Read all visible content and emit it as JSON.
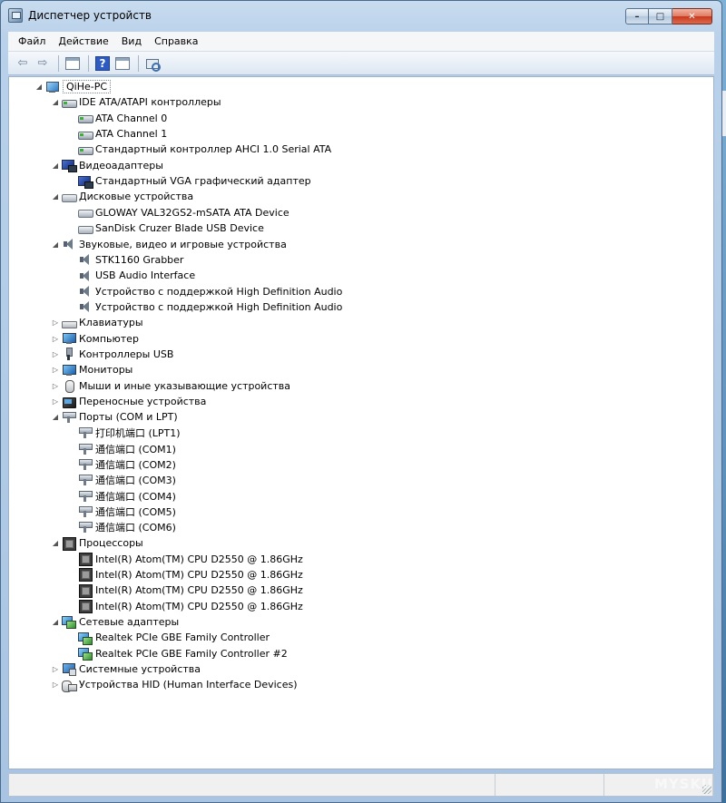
{
  "window": {
    "title": "Диспетчер устройств",
    "buttons": {
      "minimize": "–",
      "maximize": "□",
      "close": "✕"
    }
  },
  "menu": [
    "Файл",
    "Действие",
    "Вид",
    "Справка"
  ],
  "toolbar": {
    "back_icon": "arrow-left-icon",
    "forward_icon": "arrow-right-icon",
    "help_label": "?"
  },
  "tree": [
    {
      "level": 0,
      "label": "QiHe-PC",
      "icon": "computer",
      "expander": "◢",
      "root": true
    },
    {
      "level": 1,
      "label": "IDE ATA/ATAPI контроллеры",
      "icon": "ide",
      "expander": "◢"
    },
    {
      "level": 2,
      "label": "ATA Channel 0",
      "icon": "ide",
      "expander": ""
    },
    {
      "level": 2,
      "label": "ATA Channel 1",
      "icon": "ide",
      "expander": ""
    },
    {
      "level": 2,
      "label": "Стандартный контроллер AHCI 1.0 Serial ATA",
      "icon": "ide",
      "expander": ""
    },
    {
      "level": 1,
      "label": "Видеоадаптеры",
      "icon": "display",
      "expander": "◢"
    },
    {
      "level": 2,
      "label": "Стандартный VGA графический адаптер",
      "icon": "display",
      "expander": ""
    },
    {
      "level": 1,
      "label": "Дисковые устройства",
      "icon": "disk",
      "expander": "◢"
    },
    {
      "level": 2,
      "label": "GLOWAY VAL32GS2-mSATA ATA Device",
      "icon": "disk",
      "expander": ""
    },
    {
      "level": 2,
      "label": "SanDisk Cruzer Blade USB Device",
      "icon": "disk",
      "expander": ""
    },
    {
      "level": 1,
      "label": "Звуковые, видео и игровые устройства",
      "icon": "sound",
      "expander": "◢"
    },
    {
      "level": 2,
      "label": "STK1160 Grabber",
      "icon": "sound",
      "expander": ""
    },
    {
      "level": 2,
      "label": "USB Audio Interface",
      "icon": "sound",
      "expander": ""
    },
    {
      "level": 2,
      "label": "Устройство с поддержкой High Definition Audio",
      "icon": "sound",
      "expander": ""
    },
    {
      "level": 2,
      "label": "Устройство с поддержкой High Definition Audio",
      "icon": "sound",
      "expander": ""
    },
    {
      "level": 1,
      "label": "Клавиатуры",
      "icon": "keyboard",
      "expander": "▷"
    },
    {
      "level": 1,
      "label": "Компьютер",
      "icon": "monitor",
      "expander": "▷"
    },
    {
      "level": 1,
      "label": "Контроллеры USB",
      "icon": "usb",
      "expander": "▷"
    },
    {
      "level": 1,
      "label": "Мониторы",
      "icon": "monitor",
      "expander": "▷"
    },
    {
      "level": 1,
      "label": "Мыши и иные указывающие устройства",
      "icon": "mouse",
      "expander": "▷"
    },
    {
      "level": 1,
      "label": "Переносные устройства",
      "icon": "portable",
      "expander": "▷"
    },
    {
      "level": 1,
      "label": "Порты (COM и LPT)",
      "icon": "port",
      "expander": "◢"
    },
    {
      "level": 2,
      "label": "打印机端口 (LPT1)",
      "icon": "port",
      "expander": ""
    },
    {
      "level": 2,
      "label": "通信端口 (COM1)",
      "icon": "port",
      "expander": ""
    },
    {
      "level": 2,
      "label": "通信端口 (COM2)",
      "icon": "port",
      "expander": ""
    },
    {
      "level": 2,
      "label": "通信端口 (COM3)",
      "icon": "port",
      "expander": ""
    },
    {
      "level": 2,
      "label": "通信端口 (COM4)",
      "icon": "port",
      "expander": ""
    },
    {
      "level": 2,
      "label": "通信端口 (COM5)",
      "icon": "port",
      "expander": ""
    },
    {
      "level": 2,
      "label": "通信端口 (COM6)",
      "icon": "port",
      "expander": ""
    },
    {
      "level": 1,
      "label": "Процессоры",
      "icon": "cpu",
      "expander": "◢"
    },
    {
      "level": 2,
      "label": "Intel(R) Atom(TM) CPU D2550   @ 1.86GHz",
      "icon": "cpu",
      "expander": ""
    },
    {
      "level": 2,
      "label": "Intel(R) Atom(TM) CPU D2550   @ 1.86GHz",
      "icon": "cpu",
      "expander": ""
    },
    {
      "level": 2,
      "label": "Intel(R) Atom(TM) CPU D2550   @ 1.86GHz",
      "icon": "cpu",
      "expander": ""
    },
    {
      "level": 2,
      "label": "Intel(R) Atom(TM) CPU D2550   @ 1.86GHz",
      "icon": "cpu",
      "expander": ""
    },
    {
      "level": 1,
      "label": "Сетевые адаптеры",
      "icon": "net",
      "expander": "◢"
    },
    {
      "level": 2,
      "label": "Realtek PCIe GBE Family Controller",
      "icon": "net",
      "expander": ""
    },
    {
      "level": 2,
      "label": "Realtek PCIe GBE Family Controller #2",
      "icon": "net",
      "expander": ""
    },
    {
      "level": 1,
      "label": "Системные устройства",
      "icon": "system",
      "expander": "▷"
    },
    {
      "level": 1,
      "label": "Устройства HID (Human Interface Devices)",
      "icon": "hid",
      "expander": "▷"
    }
  ],
  "watermark": "MYSKU"
}
